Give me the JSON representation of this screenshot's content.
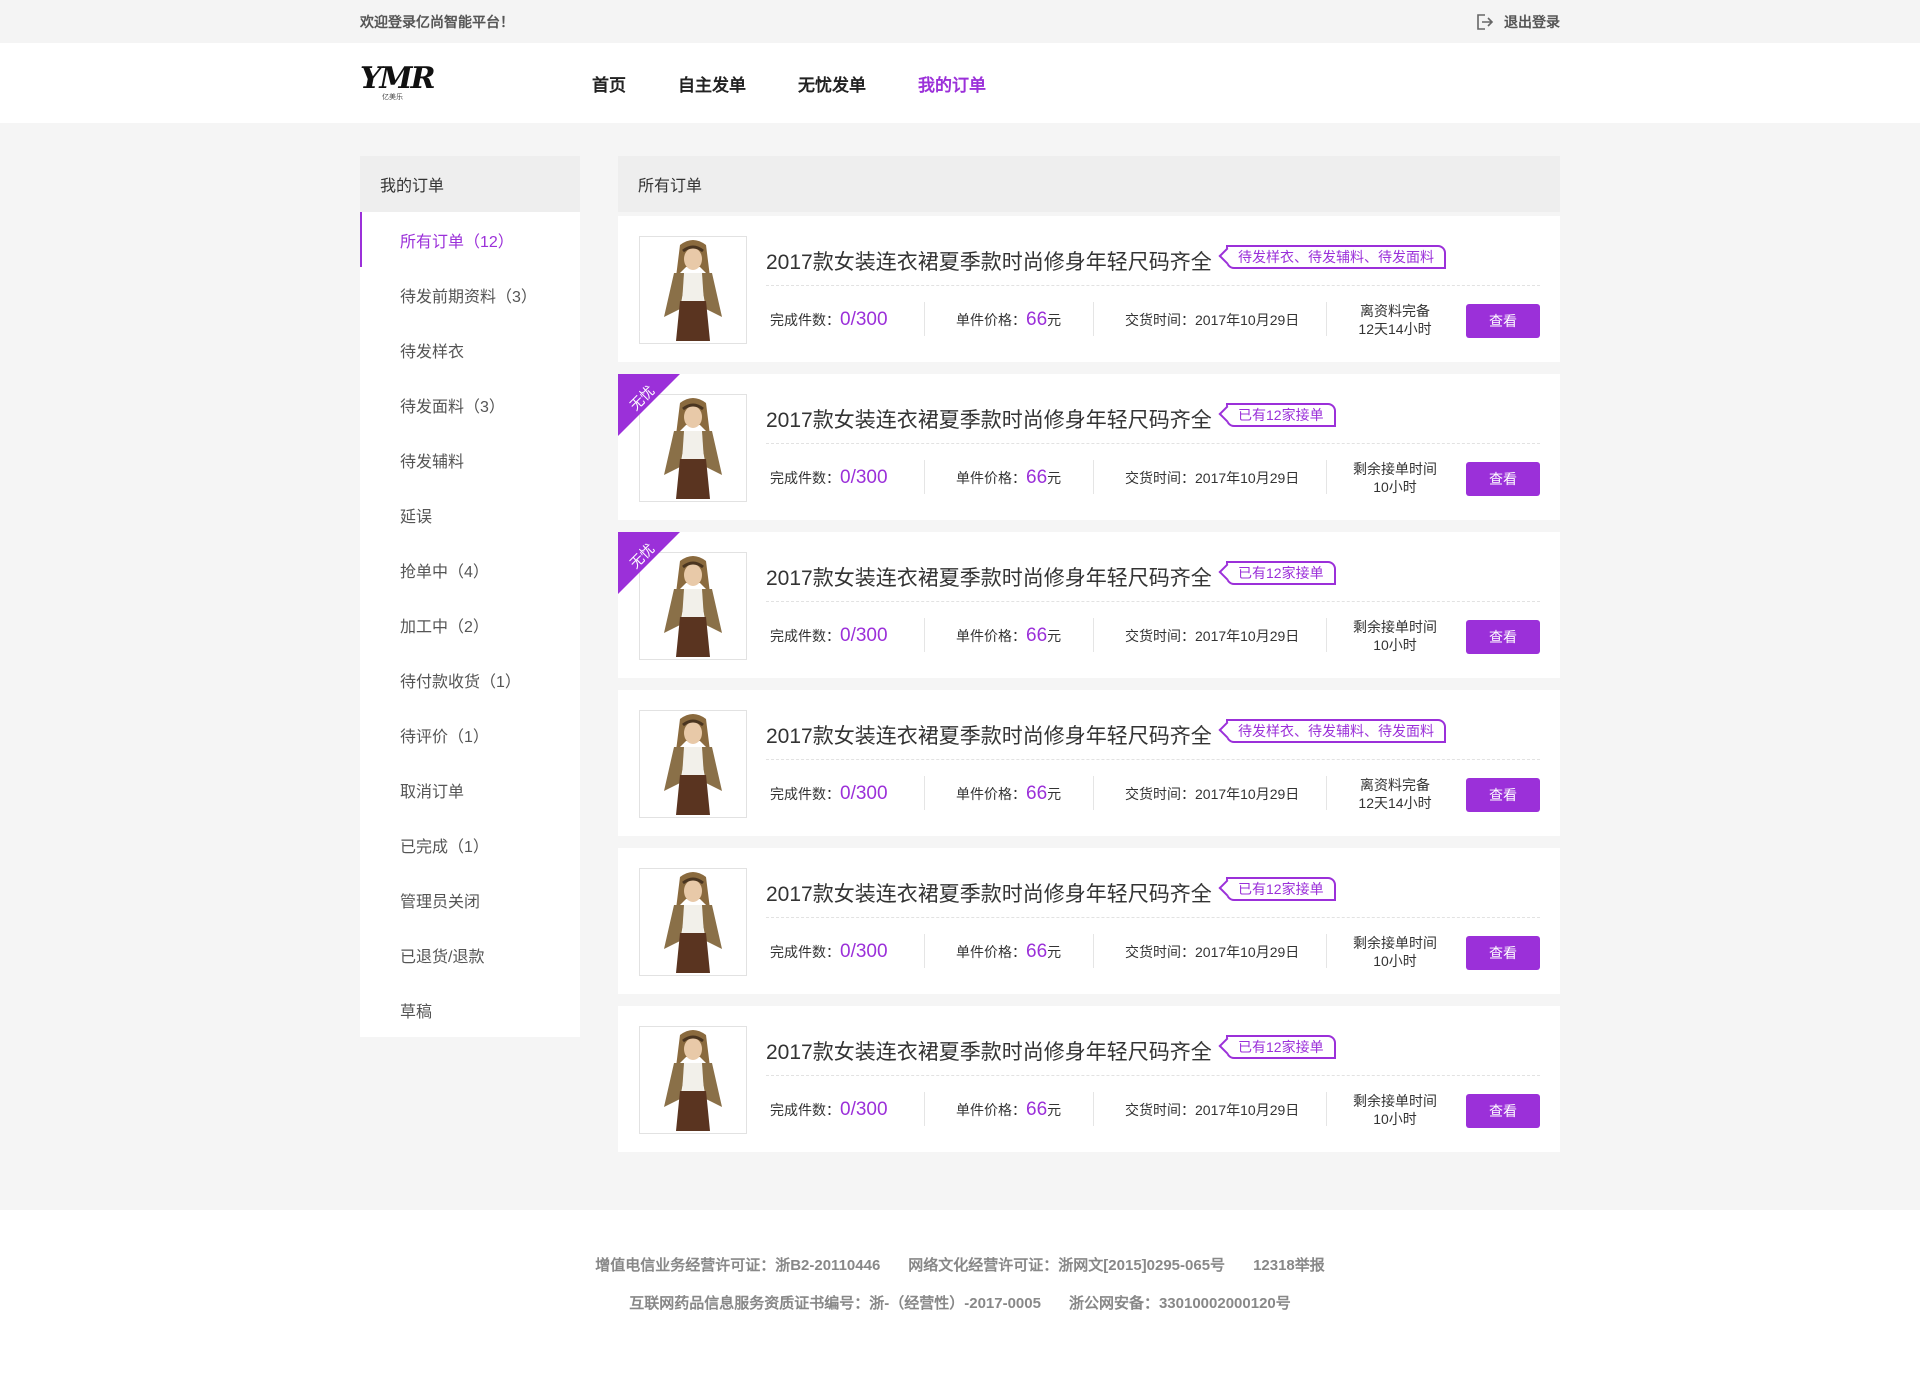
{
  "topbar": {
    "welcome": "欢迎登录亿尚智能平台！",
    "logout_label": "退出登录"
  },
  "header": {
    "logo_mark": "YMR",
    "logo_sub": "亿美乐",
    "nav": [
      {
        "label": "首页",
        "active": false
      },
      {
        "label": "自主发单",
        "active": false
      },
      {
        "label": "无忧发单",
        "active": false
      },
      {
        "label": "我的订单",
        "active": true
      }
    ]
  },
  "sidebar": {
    "title": "我的订单",
    "items": [
      {
        "label": "所有订单（12）",
        "active": true
      },
      {
        "label": "待发前期资料（3）",
        "active": false
      },
      {
        "label": "待发样衣",
        "active": false
      },
      {
        "label": "待发面料（3）",
        "active": false
      },
      {
        "label": "待发辅料",
        "active": false
      },
      {
        "label": "延误",
        "active": false
      },
      {
        "label": "抢单中（4）",
        "active": false
      },
      {
        "label": "加工中（2）",
        "active": false
      },
      {
        "label": "待付款收货（1）",
        "active": false
      },
      {
        "label": "待评价（1）",
        "active": false
      },
      {
        "label": "取消订单",
        "active": false
      },
      {
        "label": "已完成（1）",
        "active": false
      },
      {
        "label": "管理员关闭",
        "active": false
      },
      {
        "label": "已退货/退款",
        "active": false
      },
      {
        "label": "草稿",
        "active": false
      }
    ]
  },
  "content": {
    "title": "所有订单",
    "labels": {
      "completed": "完成件数：",
      "price": "单件价格：",
      "price_unit": "元",
      "delivery": "交货时间：",
      "view_button": "查看"
    },
    "orders": [
      {
        "title": "2017款女装连衣裙夏季款时尚修身年轻尺码齐全",
        "tag": "待发样衣、待发辅料、待发面料",
        "ribbon": "",
        "completed": "0/300",
        "price": "66",
        "delivery": "2017年10月29日",
        "remain_line1": "离资料完备",
        "remain_line2": "12天14小时"
      },
      {
        "title": "2017款女装连衣裙夏季款时尚修身年轻尺码齐全",
        "tag": "已有12家接单",
        "ribbon": "无忧",
        "completed": "0/300",
        "price": "66",
        "delivery": "2017年10月29日",
        "remain_line1": "剩余接单时间",
        "remain_line2": "10小时"
      },
      {
        "title": "2017款女装连衣裙夏季款时尚修身年轻尺码齐全",
        "tag": "已有12家接单",
        "ribbon": "无忧",
        "completed": "0/300",
        "price": "66",
        "delivery": "2017年10月29日",
        "remain_line1": "剩余接单时间",
        "remain_line2": "10小时"
      },
      {
        "title": "2017款女装连衣裙夏季款时尚修身年轻尺码齐全",
        "tag": "待发样衣、待发辅料、待发面料",
        "ribbon": "",
        "completed": "0/300",
        "price": "66",
        "delivery": "2017年10月29日",
        "remain_line1": "离资料完备",
        "remain_line2": "12天14小时"
      },
      {
        "title": "2017款女装连衣裙夏季款时尚修身年轻尺码齐全",
        "tag": "已有12家接单",
        "ribbon": "",
        "completed": "0/300",
        "price": "66",
        "delivery": "2017年10月29日",
        "remain_line1": "剩余接单时间",
        "remain_line2": "10小时"
      },
      {
        "title": "2017款女装连衣裙夏季款时尚修身年轻尺码齐全",
        "tag": "已有12家接单",
        "ribbon": "",
        "completed": "0/300",
        "price": "66",
        "delivery": "2017年10月29日",
        "remain_line1": "剩余接单时间",
        "remain_line2": "10小时"
      }
    ]
  },
  "footer": {
    "line1": [
      "增值电信业务经营许可证：浙B2-20110446",
      "网络文化经营许可证：浙网文[2015]0295-065号",
      "12318举报"
    ],
    "line2": [
      "互联网药品信息服务资质证书编号：浙-（经营性）-2017-0005",
      "浙公网安备：33010002000120号"
    ]
  },
  "colors": {
    "accent": "#9b30d9",
    "background": "#f5f5f5",
    "panel_header": "#eeeeee"
  },
  "icons": {
    "logout": "logout-icon",
    "thumbnail": "dress-model-photo"
  }
}
